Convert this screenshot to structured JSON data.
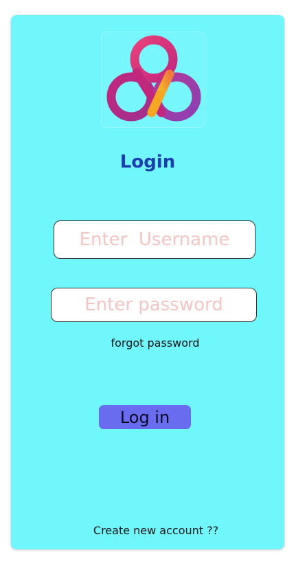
{
  "logo": {
    "icon": "trefoil-knot-logo-icon",
    "colors": {
      "magenta": "#c2277e",
      "purple": "#8e3fb3",
      "orange": "#f5a623",
      "pink": "#e8417a"
    }
  },
  "header": {
    "title": "Login"
  },
  "form": {
    "username_placeholder": "Enter  Username",
    "username_value": "",
    "password_placeholder": "Enter password",
    "password_value": "",
    "forgot_label": "forgot password",
    "submit_label": "Log in"
  },
  "footer": {
    "create_account_label": "Create new account ??"
  },
  "colors": {
    "card_background": "#6ff7fb",
    "title": "#1e3cb4",
    "button": "#6a6cf0",
    "placeholder": "#f7c4c4"
  }
}
